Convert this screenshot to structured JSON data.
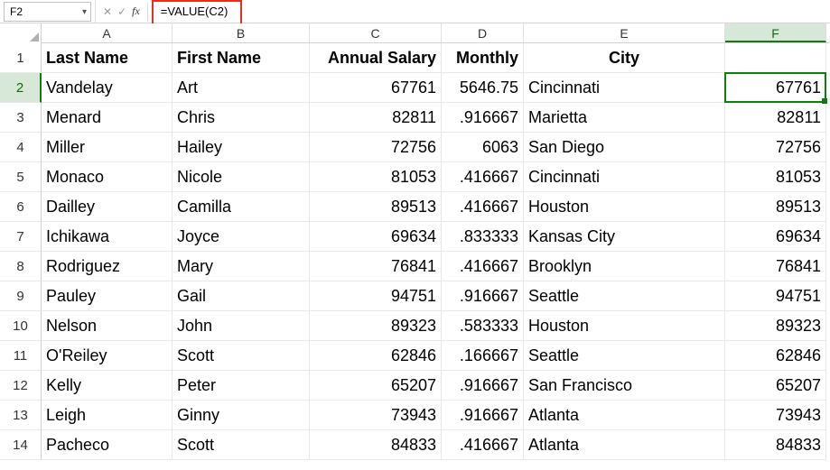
{
  "formulaBar": {
    "nameBox": "F2",
    "formula": "=VALUE(C2)"
  },
  "columns": [
    {
      "letter": "A",
      "widthClass": "wA"
    },
    {
      "letter": "B",
      "widthClass": "wB"
    },
    {
      "letter": "C",
      "widthClass": "wC"
    },
    {
      "letter": "D",
      "widthClass": "wD"
    },
    {
      "letter": "E",
      "widthClass": "wE"
    },
    {
      "letter": "F",
      "widthClass": "wF"
    }
  ],
  "selectedCol": "F",
  "selectedRow": 2,
  "headerRow": {
    "A": "Last Name",
    "B": "First Name",
    "C": "Annual Salary",
    "D": "Monthly",
    "E": "City",
    "F": ""
  },
  "rows": [
    {
      "n": 2,
      "A": "Vandelay",
      "B": "Art",
      "C": "67761",
      "D": "5646.75",
      "E": "Cincinnati",
      "F": "67761"
    },
    {
      "n": 3,
      "A": "Menard",
      "B": "Chris",
      "C": "82811",
      "D": ".916667",
      "E": "Marietta",
      "F": "82811"
    },
    {
      "n": 4,
      "A": "Miller",
      "B": "Hailey",
      "C": "72756",
      "D": "6063",
      "E": "San Diego",
      "F": "72756"
    },
    {
      "n": 5,
      "A": "Monaco",
      "B": "Nicole",
      "C": "81053",
      "D": ".416667",
      "E": "Cincinnati",
      "F": "81053"
    },
    {
      "n": 6,
      "A": "Dailley",
      "B": "Camilla",
      "C": "89513",
      "D": ".416667",
      "E": "Houston",
      "F": "89513"
    },
    {
      "n": 7,
      "A": "Ichikawa",
      "B": "Joyce",
      "C": "69634",
      "D": ".833333",
      "E": "Kansas City",
      "F": "69634"
    },
    {
      "n": 8,
      "A": "Rodriguez",
      "B": "Mary",
      "C": "76841",
      "D": ".416667",
      "E": "Brooklyn",
      "F": "76841"
    },
    {
      "n": 9,
      "A": "Pauley",
      "B": "Gail",
      "C": "94751",
      "D": ".916667",
      "E": "Seattle",
      "F": "94751"
    },
    {
      "n": 10,
      "A": "Nelson",
      "B": "John",
      "C": "89323",
      "D": ".583333",
      "E": "Houston",
      "F": "89323"
    },
    {
      "n": 11,
      "A": "O'Reiley",
      "B": "Scott",
      "C": "62846",
      "D": ".166667",
      "E": "Seattle",
      "F": "62846"
    },
    {
      "n": 12,
      "A": "Kelly",
      "B": "Peter",
      "C": "65207",
      "D": ".916667",
      "E": "San Francisco",
      "F": "65207"
    },
    {
      "n": 13,
      "A": "Leigh",
      "B": "Ginny",
      "C": "73943",
      "D": ".916667",
      "E": "Atlanta",
      "F": "73943"
    },
    {
      "n": 14,
      "A": "Pacheco",
      "B": "Scott",
      "C": "84833",
      "D": ".416667",
      "E": "Atlanta",
      "F": "84833"
    }
  ]
}
